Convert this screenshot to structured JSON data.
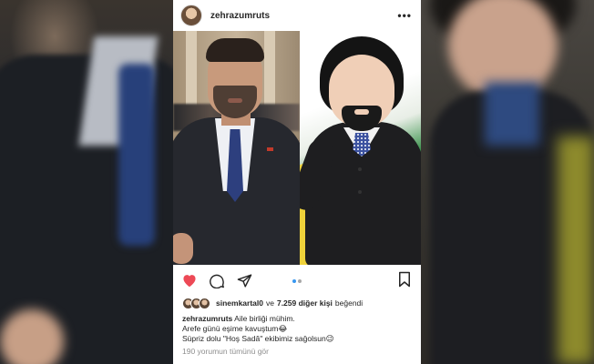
{
  "post": {
    "username": "zehrazumruts",
    "more_icon": "more-horizontal-icon",
    "carousel": {
      "slides": 2,
      "active": 1
    },
    "actions": {
      "like_icon": "heart-filled-icon",
      "comment_icon": "comment-icon",
      "share_icon": "paper-plane-icon",
      "save_icon": "bookmark-icon"
    },
    "likes": {
      "first_user": "sinemkartal0",
      "connector": "ve",
      "others": "7.259 diğer kişi",
      "suffix": "beğendi"
    },
    "caption": {
      "username": "zehrazumruts",
      "line1": "Aile birliği mühim.",
      "line2": "Arefe günü eşime kavuştum😂",
      "line3": "Süpriz dolu \"Hoş Sadâ\" ekibimiz sağolsun😉"
    },
    "comments_link": "190 yorumun tümünü gör"
  },
  "colors": {
    "heart": "#ed4956",
    "text": "#262626",
    "muted": "#8e8e8e",
    "carousel_active": "#3897f0",
    "carousel_inactive": "#a8a8a8"
  }
}
